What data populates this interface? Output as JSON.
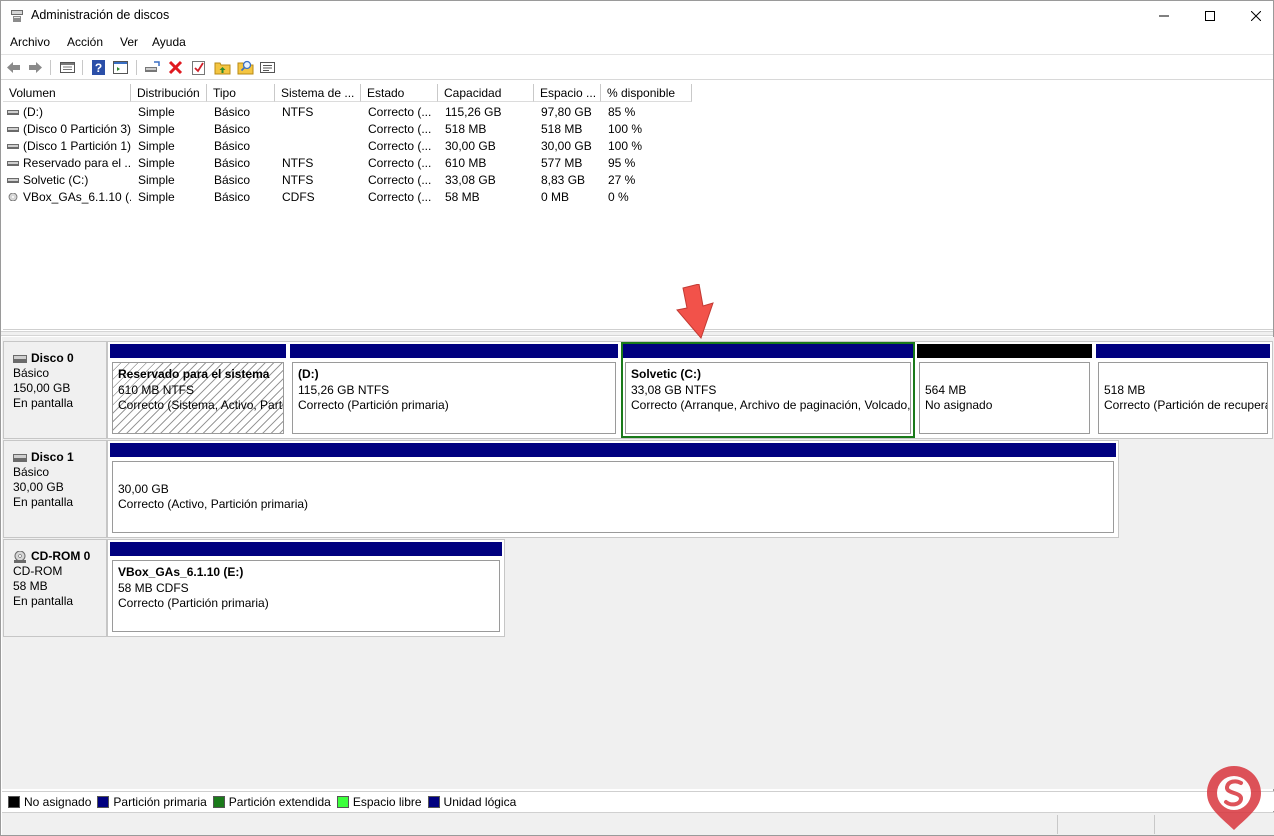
{
  "window": {
    "title": "Administración de discos",
    "min": "—",
    "max": "☐",
    "close": "✕"
  },
  "menu": [
    "Archivo",
    "Acción",
    "Ver",
    "Ayuda"
  ],
  "toolbar": [
    "back-icon",
    "forward-icon",
    "list-view-icon",
    "help-icon",
    "console-icon",
    "connect-drive-icon",
    "delete-icon",
    "check-icon",
    "folder-up-icon",
    "folder-search-icon",
    "properties-icon"
  ],
  "columns": [
    "Volumen",
    "Distribución",
    "Tipo",
    "Sistema de ...",
    "Estado",
    "Capacidad",
    "Espacio ...",
    "% disponible"
  ],
  "volumes": [
    {
      "name": "(D:)",
      "layout": "Simple",
      "type": "Básico",
      "fs": "NTFS",
      "status": "Correcto (...",
      "capacity": "115,26 GB",
      "free": "97,80 GB",
      "pct": "85 %"
    },
    {
      "name": "(Disco 0 Partición 3)",
      "layout": "Simple",
      "type": "Básico",
      "fs": "",
      "status": "Correcto (...",
      "capacity": "518 MB",
      "free": "518 MB",
      "pct": "100 %"
    },
    {
      "name": "(Disco 1 Partición 1)",
      "layout": "Simple",
      "type": "Básico",
      "fs": "",
      "status": "Correcto (...",
      "capacity": "30,00 GB",
      "free": "30,00 GB",
      "pct": "100 %"
    },
    {
      "name": "Reservado para el ...",
      "layout": "Simple",
      "type": "Básico",
      "fs": "NTFS",
      "status": "Correcto (...",
      "capacity": "610 MB",
      "free": "577 MB",
      "pct": "95 %"
    },
    {
      "name": "Solvetic (C:)",
      "layout": "Simple",
      "type": "Básico",
      "fs": "NTFS",
      "status": "Correcto (...",
      "capacity": "33,08 GB",
      "free": "8,83 GB",
      "pct": "27 %"
    },
    {
      "name": "VBox_GAs_6.1.10 (...",
      "layout": "Simple",
      "type": "Básico",
      "fs": "CDFS",
      "status": "Correcto (...",
      "capacity": "58 MB",
      "free": "0 MB",
      "pct": "0 %"
    }
  ],
  "disks": [
    {
      "name": "Disco 0",
      "kind": "Básico",
      "size": "150,00 GB",
      "state": "En pantalla",
      "partitions": [
        {
          "title": "Reservado para el sistema",
          "size": "610 MB NTFS",
          "status": "Correcto (Sistema, Activo, Partición primaria)",
          "style": "hatched"
        },
        {
          "title": "(D:)",
          "size": "115,26 GB NTFS",
          "status": "Correcto (Partición primaria)",
          "style": "normal"
        },
        {
          "title": "Solvetic  (C:)",
          "size": "33,08 GB NTFS",
          "status": "Correcto (Arranque, Archivo de paginación, Volcado, Partición primaria)",
          "style": "selected"
        },
        {
          "title": "",
          "size": "564 MB",
          "status": "No asignado",
          "style": "unalloc"
        },
        {
          "title": "",
          "size": "518 MB",
          "status": "Correcto (Partición de recuperación)",
          "style": "normal"
        }
      ]
    },
    {
      "name": "Disco 1",
      "kind": "Básico",
      "size": "30,00 GB",
      "state": "En pantalla",
      "partitions": [
        {
          "title": "",
          "size": "30,00 GB",
          "status": "Correcto (Activo, Partición primaria)",
          "style": "normal"
        }
      ]
    },
    {
      "name": "CD-ROM 0",
      "kind": "CD-ROM",
      "size": "58 MB",
      "state": "En pantalla",
      "partitions": [
        {
          "title": "VBox_GAs_6.1.10  (E:)",
          "size": "58 MB CDFS",
          "status": "Correcto (Partición primaria)",
          "style": "normal"
        }
      ]
    }
  ],
  "legend": [
    {
      "label": "No asignado",
      "color": "#000000"
    },
    {
      "label": "Partición primaria",
      "color": "#00007f"
    },
    {
      "label": "Partición extendida",
      "color": "#1a7a1a"
    },
    {
      "label": "Espacio libre",
      "color": "#3cff3c"
    },
    {
      "label": "Unidad lógica",
      "color": "#00007f"
    }
  ],
  "colors": {
    "primary_bar": "#00007f",
    "selection": "#1a7a1a",
    "arrow": "#f2524a",
    "watermark": "#d9363e"
  }
}
